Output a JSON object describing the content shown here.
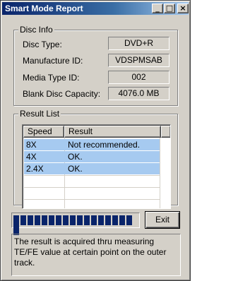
{
  "window": {
    "title": "Smart Mode Report"
  },
  "title_buttons": {
    "minimize": "_",
    "maximize": "□",
    "close": "×"
  },
  "disc_info": {
    "label": "Disc Info",
    "fields": [
      {
        "label": "Disc Type:",
        "value": "DVD+R"
      },
      {
        "label": "Manufacture ID:",
        "value": "VDSPMSAB"
      },
      {
        "label": "Media Type ID:",
        "value": "002"
      },
      {
        "label": "Blank Disc Capacity:",
        "value": "4076.0 MB"
      }
    ]
  },
  "result_list": {
    "label": "Result List",
    "columns": [
      "Speed",
      "Result"
    ],
    "rows": [
      {
        "speed": "8X",
        "result": "Not recommended."
      },
      {
        "speed": "4X",
        "result": "OK."
      },
      {
        "speed": "2.4X",
        "result": "OK."
      }
    ]
  },
  "progress": {
    "value_percent": 100
  },
  "exit_label": "Exit",
  "message": "The result is acquired thru measuring TE/FE value at certain point on the outer track."
}
